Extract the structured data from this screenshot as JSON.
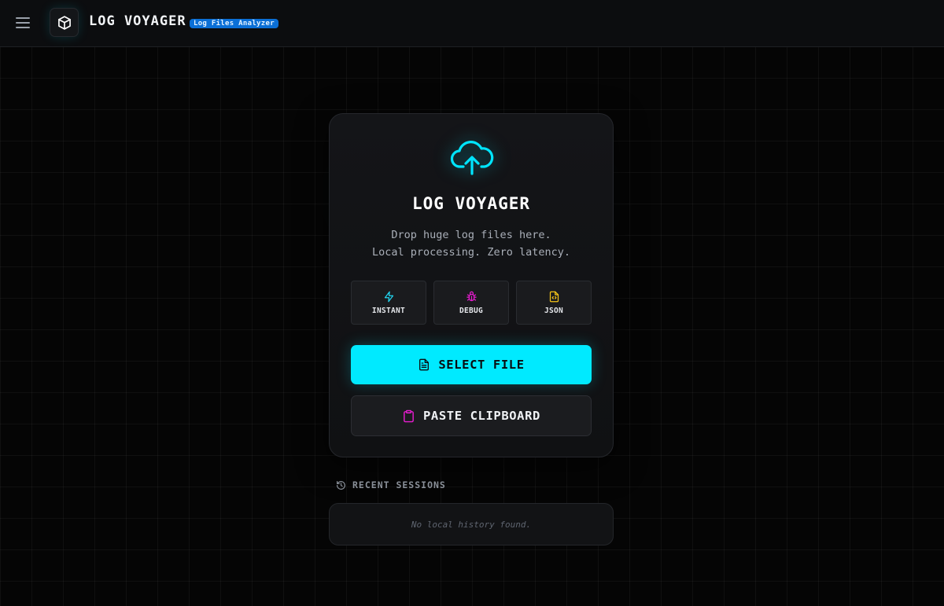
{
  "header": {
    "title": "LOG VOYAGER",
    "badge": "Log Files Analyzer",
    "menu_icon": "hamburger-menu-icon",
    "logo_icon": "cube-icon"
  },
  "card": {
    "icon": "cloud-upload-icon",
    "title": "LOG VOYAGER",
    "description_line1": "Drop huge log files here.",
    "description_line2": "Local processing. Zero latency.",
    "features": [
      {
        "label": "INSTANT",
        "icon": "lightning-icon",
        "color": "#22d3ee"
      },
      {
        "label": "DEBUG",
        "icon": "bug-icon",
        "color": "#e81cd0"
      },
      {
        "label": "JSON",
        "icon": "json-file-icon",
        "color": "#f5c518"
      }
    ],
    "select_file_label": "SELECT FILE",
    "paste_clipboard_label": "PASTE CLIPBOARD"
  },
  "recent": {
    "title": "RECENT SESSIONS",
    "icon": "history-icon",
    "empty_message": "No local history found."
  },
  "colors": {
    "accent_cyan": "#00eaff",
    "accent_magenta": "#e81cd0",
    "accent_yellow": "#f5c518",
    "badge_blue": "#0b6fd6"
  }
}
